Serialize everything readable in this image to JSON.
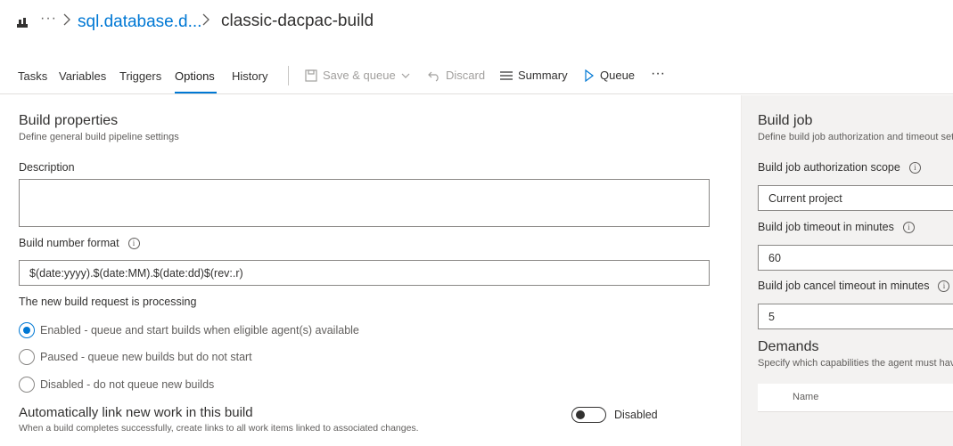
{
  "breadcrumb": {
    "icon": "build-pipeline-icon",
    "ellipsis": "···",
    "link": "sql.database.d...",
    "title": "classic-dacpac-build"
  },
  "tabs": [
    {
      "label": "Tasks"
    },
    {
      "label": "Variables"
    },
    {
      "label": "Triggers"
    },
    {
      "label": "Options",
      "active": true
    },
    {
      "label": "History"
    }
  ],
  "toolbar": {
    "save_queue": "Save & queue",
    "discard": "Discard",
    "summary": "Summary",
    "queue": "Queue",
    "more": "···"
  },
  "build_properties": {
    "title": "Build properties",
    "subtitle": "Define general build pipeline settings",
    "description_label": "Description",
    "description_value": "",
    "build_number_label": "Build number format",
    "build_number_value": "$(date:yyyy).$(date:MM).$(date:dd)$(rev:.r)",
    "processing_label": "The new build request is processing",
    "options": [
      {
        "label": "Enabled - queue and start builds when eligible agent(s) available",
        "checked": true
      },
      {
        "label": "Paused - queue new builds but do not start",
        "checked": false
      },
      {
        "label": "Disabled - do not queue new builds",
        "checked": false
      }
    ],
    "autolink_title": "Automatically link new work in this build",
    "autolink_sub": "When a build completes successfully, create links to all work items linked to associated changes.",
    "autolink_state": "Disabled"
  },
  "build_job": {
    "title": "Build job",
    "subtitle": "Define build job authorization and timeout set",
    "scope_label": "Build job authorization scope",
    "scope_value": "Current project",
    "timeout_label": "Build job timeout in minutes",
    "timeout_value": "60",
    "cancel_timeout_label": "Build job cancel timeout in minutes",
    "cancel_timeout_value": "5"
  },
  "demands": {
    "title": "Demands",
    "subtitle": "Specify which capabilities the agent must have",
    "column_name": "Name"
  },
  "colors": {
    "accent": "#0078d4",
    "right_panel_bg": "#f3f2f1"
  }
}
